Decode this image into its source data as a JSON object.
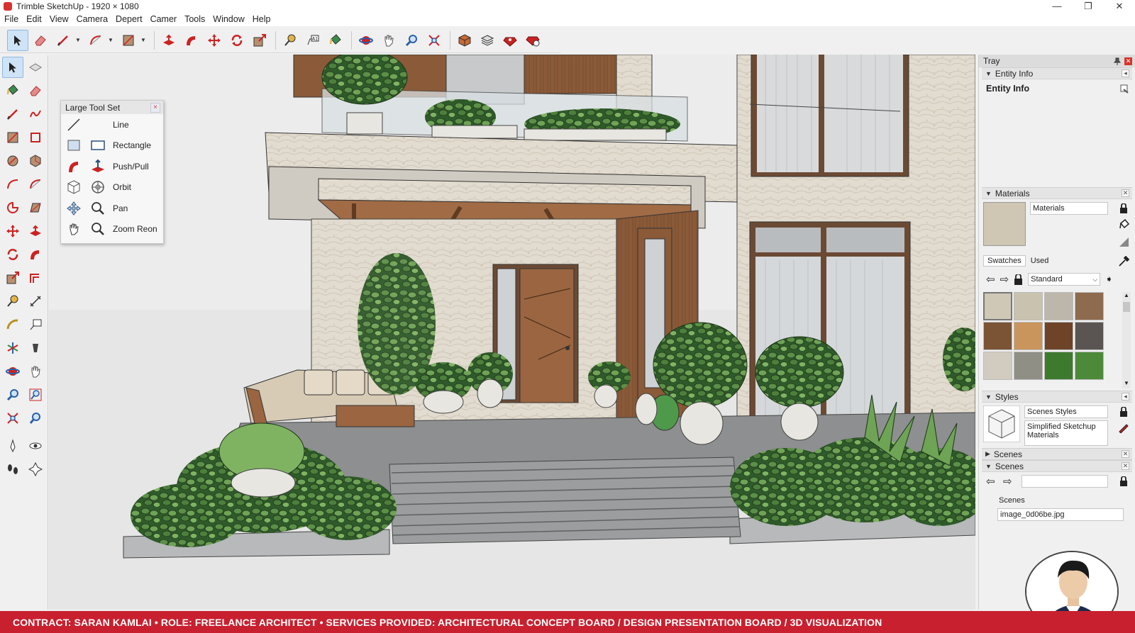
{
  "window": {
    "title": "Trimble SketchUp - 1920 × 1080",
    "minimize": "—",
    "restore": "❐",
    "close": "✕"
  },
  "menu": [
    "File",
    "Edit",
    "View",
    "Camera",
    "Depert",
    "Camer",
    "Tools",
    "Window",
    "Help"
  ],
  "large_tool_set": {
    "title": "Large Tool Set",
    "close": "×",
    "items": [
      {
        "label": "Line",
        "icon": "line-icon"
      },
      {
        "label": "Rectangle",
        "icon": "rectangle-icon"
      },
      {
        "label": "Push/Pull",
        "icon": "push-pull-icon"
      },
      {
        "label": "Orbit",
        "icon": "orbit-icon"
      },
      {
        "label": "Pan",
        "icon": "pan-icon"
      },
      {
        "label": "Zoom Reon",
        "icon": "zoom-icon"
      }
    ]
  },
  "tray": {
    "title": "Tray",
    "entity_info": {
      "header": "Entity Info",
      "title": "Entity Info"
    },
    "materials": {
      "header": "Materials",
      "name": "Materials",
      "tab_swatches": "Swatches",
      "tab_used": "Used",
      "library": "Standard",
      "swatch_colors": [
        "#cfc8b6",
        "#c9c2ae",
        "#bdb7ab",
        "#8e6a4e",
        "#7b5335",
        "#c9955c",
        "#6e4328",
        "#5a5552",
        "#d2cbbf",
        "#8f8f86",
        "#3e7a2e",
        "#4c8a3a"
      ]
    },
    "styles": {
      "header": "Styles",
      "name": "Scenes Styles",
      "description": "Simplified Sketchup Materials"
    },
    "scenes_collapsed": {
      "header": "Scenes"
    },
    "scenes": {
      "header": "Scenes",
      "label": "Scenes",
      "item": "image_0d06be.jpg"
    }
  },
  "banner": "CONTRACT: SARAN KAMLAI  • ROLE: FREELANCE ARCHITECT  • SERVICES PROVIDED: ARCHITECTURAL CONCEPT BOARD / DESIGN PRESENTATION BOARD / 3D VISUALIZATION",
  "colors": {
    "accent_red": "#c8202f",
    "select_blue": "#cfe3f7"
  }
}
